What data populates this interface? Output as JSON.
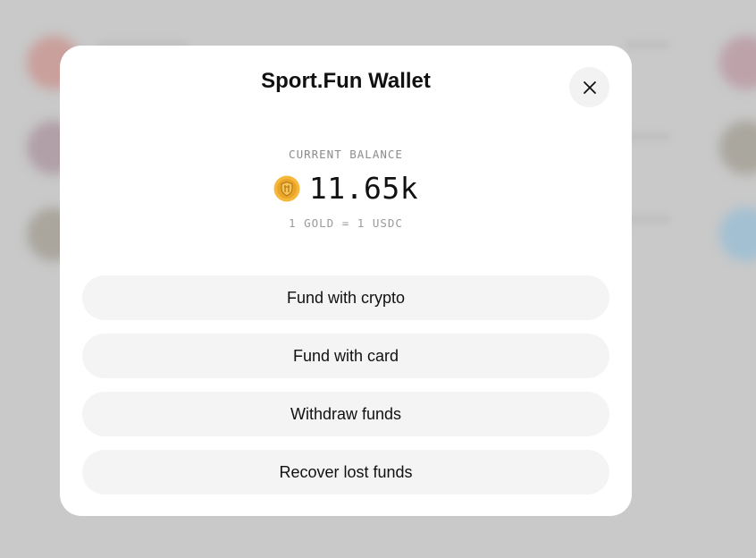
{
  "modal": {
    "title": "Sport.Fun Wallet",
    "close_icon": "close-icon"
  },
  "balance": {
    "label": "CURRENT BALANCE",
    "value": "11.65k",
    "currency_icon": "gold-coin-icon",
    "rate": "1 GOLD = 1 USDC"
  },
  "actions": [
    {
      "label": "Fund with crypto"
    },
    {
      "label": "Fund with card"
    },
    {
      "label": "Withdraw funds"
    },
    {
      "label": "Recover lost funds"
    }
  ],
  "colors": {
    "modal_bg": "#ffffff",
    "button_bg": "#f4f4f4",
    "coin": "#f5b83a",
    "backdrop": "#c9c9c9"
  }
}
